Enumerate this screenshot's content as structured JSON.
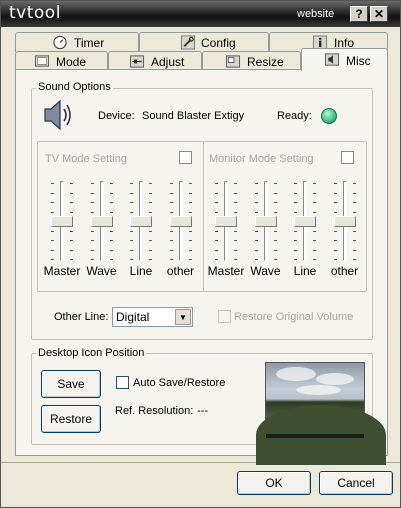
{
  "window": {
    "title": "tvtool",
    "website_label": "website",
    "help_glyph": "?",
    "close_glyph": "✕"
  },
  "tabs_back": [
    {
      "label": "Timer",
      "icon": "clock-icon"
    },
    {
      "label": "Config",
      "icon": "wrench-icon"
    },
    {
      "label": "Info",
      "icon": "info-icon"
    }
  ],
  "tabs_front": [
    {
      "label": "Mode",
      "icon": "monitor-icon"
    },
    {
      "label": "Adjust",
      "icon": "adjust-icon"
    },
    {
      "label": "Resize",
      "icon": "resize-icon"
    },
    {
      "label": "Misc",
      "icon": "speaker-icon",
      "active": true
    }
  ],
  "sound": {
    "group_title": "Sound Options",
    "device_label": "Device:",
    "device_name": "Sound Blaster Extigy",
    "ready_label": "Ready:",
    "ready_color": "#3fbf7f",
    "tv_mode": {
      "title": "TV Mode Setting",
      "checked": false
    },
    "monitor_mode": {
      "title": "Monitor Mode Setting",
      "checked": false
    },
    "slider_labels": [
      "Master",
      "Wave",
      "Line",
      "other"
    ],
    "slider_levels": [
      0.5,
      0.5,
      0.5,
      0.5
    ],
    "other_line_label": "Other Line:",
    "other_line_value": "Digital",
    "restore_volume_label": "Restore Original Volume"
  },
  "desktop": {
    "group_title": "Desktop Icon Position",
    "save_label": "Save",
    "restore_label": "Restore",
    "auto_save_label": "Auto Save/Restore",
    "ref_resolution_label": "Ref. Resolution:",
    "ref_resolution_value": "---"
  },
  "footer": {
    "ok_label": "OK",
    "cancel_label": "Cancel"
  }
}
